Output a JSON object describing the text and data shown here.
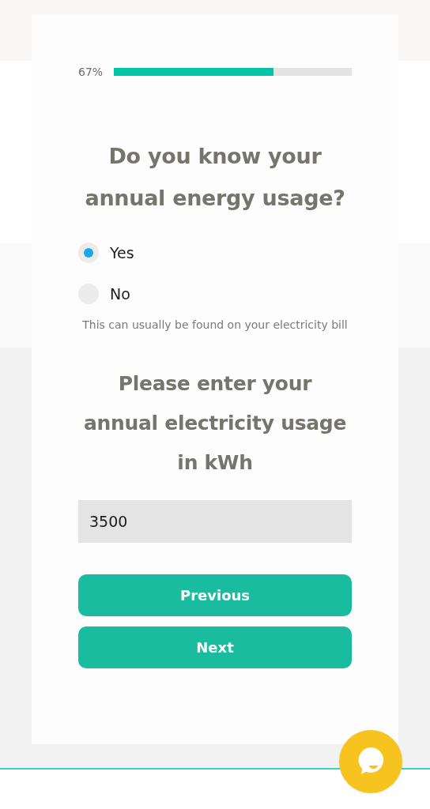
{
  "progress": {
    "label": "67%",
    "level": 0.67
  },
  "question": "Do you know your annual energy usage?",
  "options": [
    {
      "label": "Yes",
      "selected": true
    },
    {
      "label": "No",
      "selected": false
    }
  ],
  "hint": "This can usually be found on your electricity bill",
  "usage_question": "Please enter your annual electricity usage in kWh",
  "usage_field": {
    "value": "3500"
  },
  "buttons": [
    "Previous",
    "Next"
  ]
}
